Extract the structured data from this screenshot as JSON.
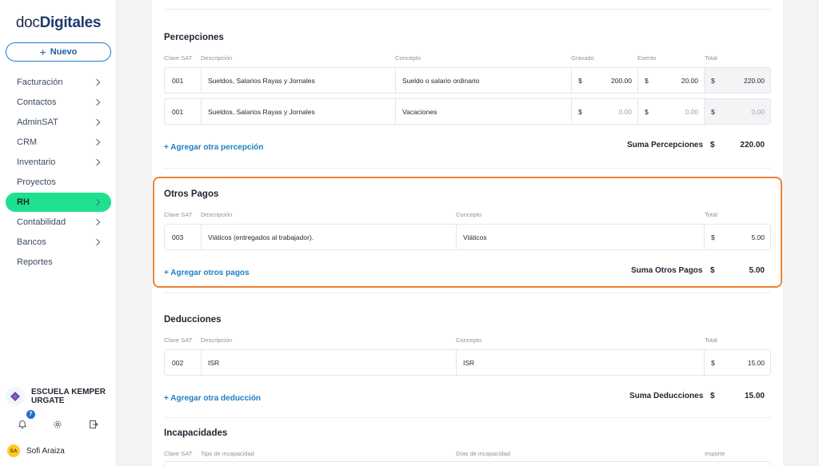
{
  "sidebar": {
    "logo": {
      "light": "doc",
      "bold": "Digitales"
    },
    "new_button": {
      "plus": "+",
      "label": "Nuevo"
    },
    "nav": [
      {
        "label": "Facturación",
        "has_chevron": true
      },
      {
        "label": "Contactos",
        "has_chevron": true
      },
      {
        "label": "AdminSAT",
        "has_chevron": true
      },
      {
        "label": "CRM",
        "has_chevron": true
      },
      {
        "label": "Inventario",
        "has_chevron": true
      },
      {
        "label": "Proyectos",
        "has_chevron": false
      },
      {
        "label": "RH",
        "has_chevron": true,
        "active": true
      },
      {
        "label": "Contabilidad",
        "has_chevron": true
      },
      {
        "label": "Bancos",
        "has_chevron": true
      },
      {
        "label": "Reportes",
        "has_chevron": false
      }
    ],
    "org": {
      "name_line1": "ESCUELA KEMPER",
      "name_line2": "URGATE"
    },
    "notifications_count": "7",
    "user": {
      "initials": "SA",
      "name": "Sofi Araiza"
    },
    "colors": {
      "accent": "#1ee08f",
      "brand": "#1f7ad3"
    }
  },
  "percepciones": {
    "title": "Percepciones",
    "headers": {
      "clave": "Clave SAT",
      "descripcion": "Descripción",
      "concepto": "Concepto",
      "gravado": "Gravado",
      "exento": "Exento",
      "total": "Total"
    },
    "rows": [
      {
        "clave": "001",
        "descripcion": "Sueldos, Salarios Rayas y Jornales",
        "concepto": "Sueldo o salario ordinario",
        "gravado_cur": "$",
        "gravado": "200.00",
        "exento_cur": "$",
        "exento": "20.00",
        "total_cur": "$",
        "total": "220.00"
      },
      {
        "clave": "001",
        "descripcion": "Sueldos, Salarios Rayas y Jornales",
        "concepto": "Vacaciones",
        "gravado_cur": "$",
        "gravado": "0.00",
        "exento_cur": "$",
        "exento": "0.00",
        "total_cur": "$",
        "total": "0.00"
      }
    ],
    "add_link": "+ Agregar otra percepción",
    "sum_label": "Suma Percepciones",
    "sum_cur": "$",
    "sum_value": "220.00"
  },
  "otros_pagos": {
    "title": "Otros Pagos",
    "headers": {
      "clave": "Clave SAT",
      "descripcion": "Descripción",
      "concepto": "Concepto",
      "total": "Total"
    },
    "rows": [
      {
        "clave": "003",
        "descripcion": "Viáticos (entregados al trabajador).",
        "concepto": "Viáticos",
        "total_cur": "$",
        "total": "5.00"
      }
    ],
    "add_link": "+ Agregar otros pagos",
    "sum_label": "Suma Otros Pagos",
    "sum_cur": "$",
    "sum_value": "5.00",
    "highlight_color": "#ee8232"
  },
  "deducciones": {
    "title": "Deducciones",
    "headers": {
      "clave": "Clave SAT",
      "descripcion": "Descripción",
      "concepto": "Concepto",
      "total": "Total"
    },
    "rows": [
      {
        "clave": "002",
        "descripcion": "ISR",
        "concepto": "ISR",
        "total_cur": "$",
        "total": "15.00"
      }
    ],
    "add_link": "+ Agregar otra deducción",
    "sum_label": "Suma Deducciones",
    "sum_cur": "$",
    "sum_value": "15.00"
  },
  "incapacidades": {
    "title": "Incapacidades",
    "headers": {
      "clave": "Clave SAT",
      "tipo": "Tipo de incapacidad",
      "dias": "Días de incapacidad",
      "importe": "Importe"
    }
  }
}
